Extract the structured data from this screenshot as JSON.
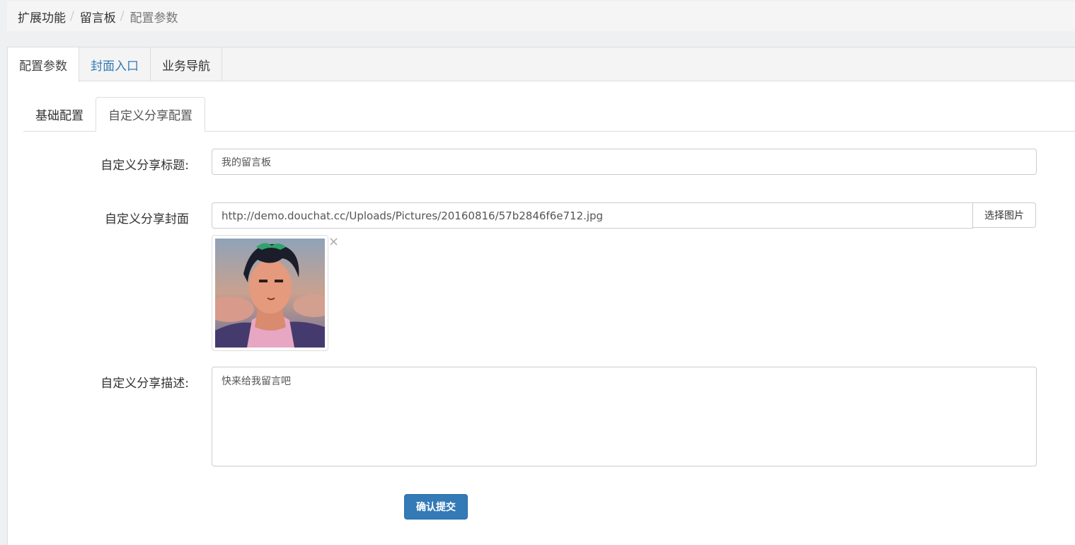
{
  "breadcrumb": {
    "items": [
      "扩展功能",
      "留言板",
      "配置参数"
    ],
    "separator": "/"
  },
  "top_tabs": [
    {
      "label": "配置参数",
      "active": true
    },
    {
      "label": "封面入口",
      "active": false
    },
    {
      "label": "业务导航",
      "active": false
    }
  ],
  "sub_tabs": [
    {
      "label": "基础配置",
      "active": false
    },
    {
      "label": "自定义分享配置",
      "active": true
    }
  ],
  "form": {
    "share_title": {
      "label": "自定义分享标题:",
      "value": "我的留言板"
    },
    "share_cover": {
      "label": "自定义分享封面",
      "value": "http://demo.douchat.cc/Uploads/Pictures/20160816/57b2846f6e712.jpg",
      "choose_button": "选择图片",
      "remove_icon": "×"
    },
    "share_desc": {
      "label": "自定义分享描述:",
      "value": "快来给我留言吧"
    },
    "submit_label": "确认提交"
  },
  "colors": {
    "primary": "#337ab7",
    "link": "#337ab7",
    "breadcrumb_bg": "#f5f5f5",
    "tab_bar_bg": "#f4f4f4"
  }
}
